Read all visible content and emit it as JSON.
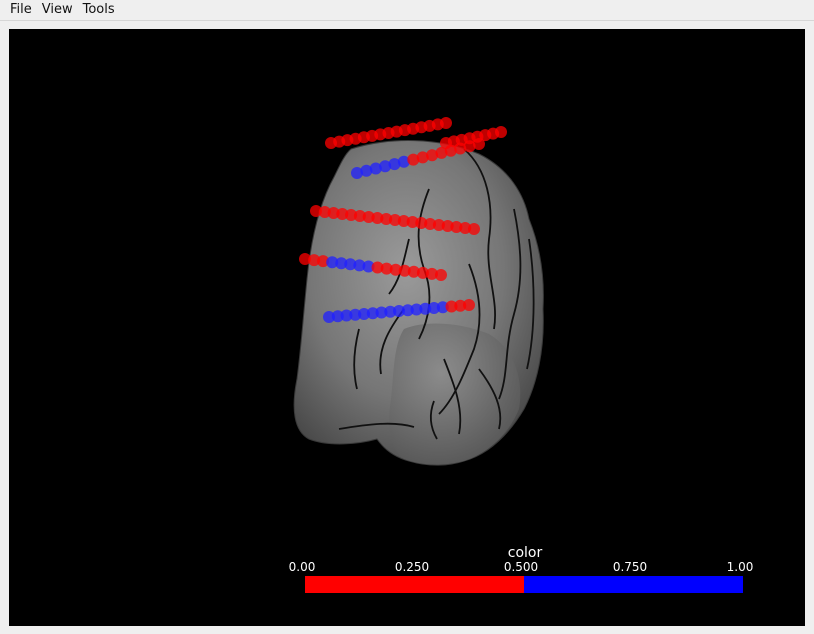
{
  "menu": {
    "file": "File",
    "view": "View",
    "tools": "Tools"
  },
  "scene": {
    "background": "#000000",
    "brain_color": "#7d7d7d",
    "electrode_red": "#ff0000",
    "electrode_blue": "#2020ff"
  },
  "colorbar": {
    "title": "color",
    "ticks": [
      "0.00",
      "0.250",
      "0.500",
      "0.750",
      "1.00"
    ],
    "segments": [
      {
        "from": 0.0,
        "to": 0.5,
        "color": "#ff0000"
      },
      {
        "from": 0.5,
        "to": 1.0,
        "color": "#0000ff"
      }
    ]
  }
}
